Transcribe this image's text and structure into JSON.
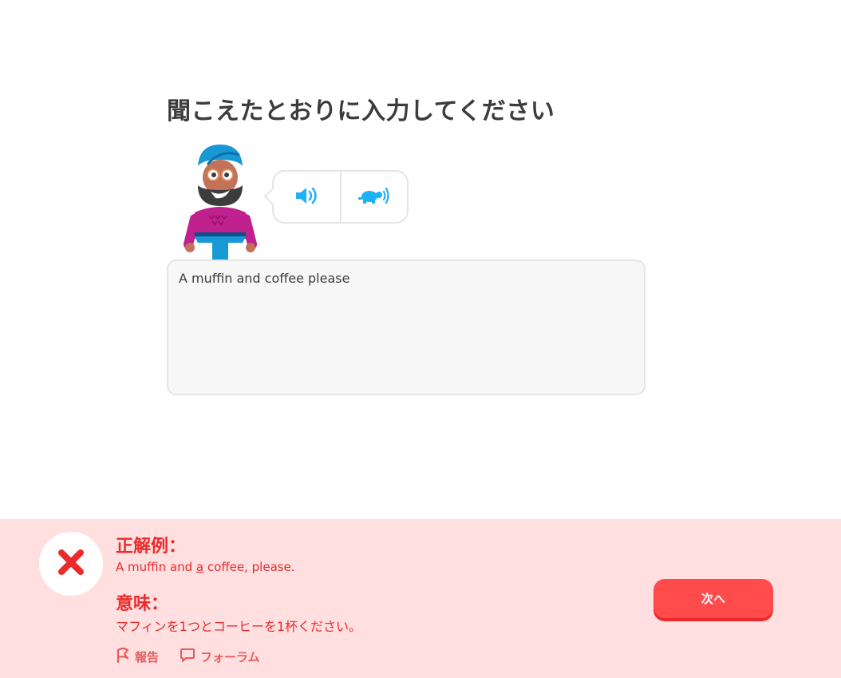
{
  "prompt": {
    "title": "聞こえたとおりに入力してください"
  },
  "audio": {
    "normal_icon": "speaker-icon",
    "slow_icon": "turtle-speaker-icon",
    "accent_color": "#1cb0f6"
  },
  "answer": {
    "value": "A muffin and coffee please"
  },
  "feedback": {
    "status_icon": "x-icon",
    "correct_heading": "正解例：",
    "correct_before": "A muffin and ",
    "correct_underlined": "a",
    "correct_after": " coffee, please.",
    "meaning_heading": "意味：",
    "meaning_text": "マフィンを1つとコーヒーを1杯ください。",
    "report_label": "報告",
    "forum_label": "フォーラム",
    "next_label": "次へ",
    "error_color": "#ea2b2b",
    "background_color": "#ffdfe0"
  }
}
